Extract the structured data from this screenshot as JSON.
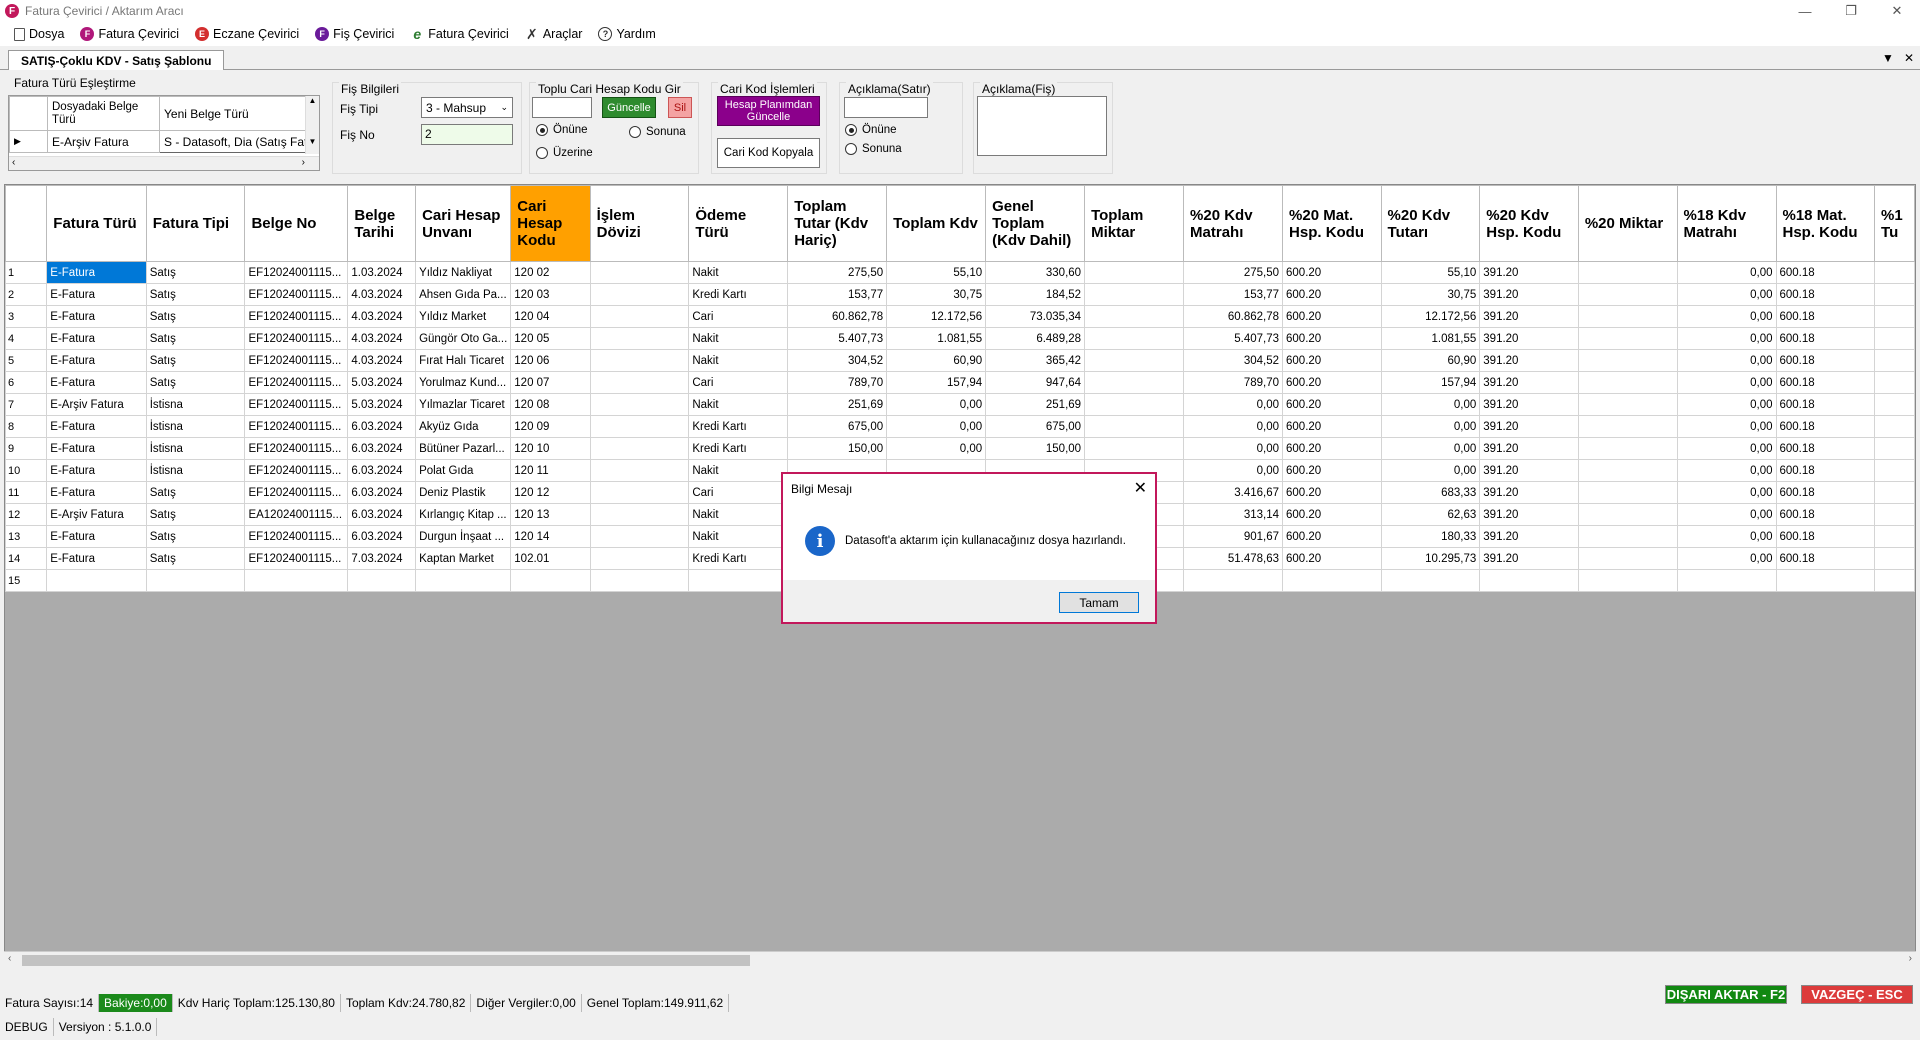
{
  "window": {
    "title": "Fatura Çevirici / Aktarım Aracı",
    "logo_letter": "F"
  },
  "menu": [
    {
      "label": "Dosya",
      "icon": "document-icon"
    },
    {
      "label": "Fatura Çevirici",
      "icon": "f-logo-icon"
    },
    {
      "label": "Eczane Çevirici",
      "icon": "e-logo-icon"
    },
    {
      "label": "Fiş Çevirici",
      "icon": "fis-logo-icon"
    },
    {
      "label": "Fatura Çevirici",
      "icon": "efatura-icon"
    },
    {
      "label": "Araçlar",
      "icon": "tools-icon"
    },
    {
      "label": "Yardım",
      "icon": "help-icon"
    }
  ],
  "tab": {
    "label": "SATIŞ-Çoklu KDV - Satış Şablonu"
  },
  "mapping": {
    "title": "Fatura Türü Eşleştirme",
    "col1": "Dosyadaki Belge Türü",
    "col2": "Yeni Belge Türü",
    "row_source": "E-Arşiv Fatura",
    "row_target": "S - Datasoft, Dia (Satış Fat"
  },
  "fis": {
    "title": "Fiş Bilgileri",
    "tipi_label": "Fiş Tipi",
    "tipi_value": "3 - Mahsup",
    "no_label": "Fiş No",
    "no_value": "2"
  },
  "toplu": {
    "title": "Toplu Cari Hesap Kodu Gir",
    "input_value": "",
    "update_btn": "Güncelle",
    "delete_btn": "Sil",
    "opt_onune": "Önüne",
    "opt_sonuna": "Sonuna",
    "opt_uzerine": "Üzerine"
  },
  "cari_islem": {
    "title": "Cari Kod İşlemleri",
    "btn_update": "Hesap Planımdan Güncelle",
    "btn_copy": "Cari Kod Kopyala"
  },
  "aciklama_satir": {
    "title": "Açıklama(Satır)",
    "value": "",
    "opt_onune": "Önüne",
    "opt_sonuna": "Sonuna"
  },
  "aciklama_fis": {
    "title": "Açıklama(Fiş)",
    "value": ""
  },
  "grid": {
    "headers": [
      "Fatura Türü",
      "Fatura Tipi",
      "Belge No",
      "Belge Tarihi",
      "Cari Hesap Unvanı",
      "Cari Hesap Kodu",
      "İşlem Dövizi",
      "Ödeme Türü",
      "Toplam Tutar (Kdv Hariç)",
      "Toplam Kdv",
      "Genel Toplam (Kdv Dahil)",
      "Toplam Miktar",
      "%20 Kdv Matrahı",
      "%20 Mat. Hsp. Kodu",
      "%20 Kdv Tutarı",
      "%20 Kdv Hsp. Kodu",
      "%20 Miktar",
      "%18 Kdv Matrahı",
      "%18 Mat. Hsp. Kodu",
      "%1 Tu"
    ],
    "rows": [
      [
        "1",
        "E-Fatura",
        "Satış",
        "EF12024001115...",
        "1.03.2024",
        "Yıldız Nakliyat",
        "120 02",
        "",
        "Nakit",
        "275,50",
        "55,10",
        "330,60",
        "",
        "275,50",
        "600.20",
        "55,10",
        "391.20",
        "",
        "0,00",
        "600.18",
        ""
      ],
      [
        "2",
        "E-Fatura",
        "Satış",
        "EF12024001115...",
        "4.03.2024",
        "Ahsen Gıda Pa...",
        "120 03",
        "",
        "Kredi Kartı",
        "153,77",
        "30,75",
        "184,52",
        "",
        "153,77",
        "600.20",
        "30,75",
        "391.20",
        "",
        "0,00",
        "600.18",
        ""
      ],
      [
        "3",
        "E-Fatura",
        "Satış",
        "EF12024001115...",
        "4.03.2024",
        "Yıldız Market",
        "120 04",
        "",
        "Cari",
        "60.862,78",
        "12.172,56",
        "73.035,34",
        "",
        "60.862,78",
        "600.20",
        "12.172,56",
        "391.20",
        "",
        "0,00",
        "600.18",
        ""
      ],
      [
        "4",
        "E-Fatura",
        "Satış",
        "EF12024001115...",
        "4.03.2024",
        "Güngör Oto Ga...",
        "120 05",
        "",
        "Nakit",
        "5.407,73",
        "1.081,55",
        "6.489,28",
        "",
        "5.407,73",
        "600.20",
        "1.081,55",
        "391.20",
        "",
        "0,00",
        "600.18",
        ""
      ],
      [
        "5",
        "E-Fatura",
        "Satış",
        "EF12024001115...",
        "4.03.2024",
        "Fırat Halı Ticaret",
        "120 06",
        "",
        "Nakit",
        "304,52",
        "60,90",
        "365,42",
        "",
        "304,52",
        "600.20",
        "60,90",
        "391.20",
        "",
        "0,00",
        "600.18",
        ""
      ],
      [
        "6",
        "E-Fatura",
        "Satış",
        "EF12024001115...",
        "5.03.2024",
        "Yorulmaz Kund...",
        "120 07",
        "",
        "Cari",
        "789,70",
        "157,94",
        "947,64",
        "",
        "789,70",
        "600.20",
        "157,94",
        "391.20",
        "",
        "0,00",
        "600.18",
        ""
      ],
      [
        "7",
        "E-Arşiv Fatura",
        "İstisna",
        "EF12024001115...",
        "5.03.2024",
        "Yılmazlar Ticaret",
        "120 08",
        "",
        "Nakit",
        "251,69",
        "0,00",
        "251,69",
        "",
        "0,00",
        "600.20",
        "0,00",
        "391.20",
        "",
        "0,00",
        "600.18",
        ""
      ],
      [
        "8",
        "E-Fatura",
        "İstisna",
        "EF12024001115...",
        "6.03.2024",
        "Akyüz Gıda",
        "120 09",
        "",
        "Kredi Kartı",
        "675,00",
        "0,00",
        "675,00",
        "",
        "0,00",
        "600.20",
        "0,00",
        "391.20",
        "",
        "0,00",
        "600.18",
        ""
      ],
      [
        "9",
        "E-Fatura",
        "İstisna",
        "EF12024001115...",
        "6.03.2024",
        "Bütüner Pazarl...",
        "120 10",
        "",
        "Kredi Kartı",
        "150,00",
        "0,00",
        "150,00",
        "",
        "0,00",
        "600.20",
        "0,00",
        "391.20",
        "",
        "0,00",
        "600.18",
        ""
      ],
      [
        "10",
        "E-Fatura",
        "İstisna",
        "EF12024001115...",
        "6.03.2024",
        "Polat Gıda",
        "120 11",
        "",
        "Nakit",
        "",
        "",
        "",
        "",
        "0,00",
        "600.20",
        "0,00",
        "391.20",
        "",
        "0,00",
        "600.18",
        ""
      ],
      [
        "11",
        "E-Fatura",
        "Satış",
        "EF12024001115...",
        "6.03.2024",
        "Deniz Plastik",
        "120 12",
        "",
        "Cari",
        "",
        "",
        "",
        "",
        "3.416,67",
        "600.20",
        "683,33",
        "391.20",
        "",
        "0,00",
        "600.18",
        ""
      ],
      [
        "12",
        "E-Arşiv Fatura",
        "Satış",
        "EA12024001115...",
        "6.03.2024",
        "Kırlangıç Kitap ...",
        "120 13",
        "",
        "Nakit",
        "",
        "",
        "",
        "",
        "313,14",
        "600.20",
        "62,63",
        "391.20",
        "",
        "0,00",
        "600.18",
        ""
      ],
      [
        "13",
        "E-Fatura",
        "Satış",
        "EF12024001115...",
        "6.03.2024",
        "Durgun İnşaat ...",
        "120 14",
        "",
        "Nakit",
        "",
        "",
        "",
        "",
        "901,67",
        "600.20",
        "180,33",
        "391.20",
        "",
        "0,00",
        "600.18",
        ""
      ],
      [
        "14",
        "E-Fatura",
        "Satış",
        "EF12024001115...",
        "7.03.2024",
        "Kaptan Market",
        "102.01",
        "",
        "Kredi Kartı",
        "",
        "",
        "",
        "",
        "51.478,63",
        "600.20",
        "10.295,73",
        "391.20",
        "",
        "0,00",
        "600.18",
        ""
      ]
    ],
    "new_row_label": "15"
  },
  "status": {
    "fatura_sayisi": "Fatura Sayısı:14",
    "bakiye": "Bakiye:0,00",
    "kdv_haric": "Kdv Hariç Toplam:125.130,80",
    "toplam_kdv": "Toplam Kdv:24.780,82",
    "diger": "Diğer Vergiler:0,00",
    "genel": "Genel Toplam:149.911,62",
    "export_btn": "DIŞARI AKTAR - F2",
    "cancel_btn": "VAZGEÇ - ESC",
    "debug": "DEBUG",
    "version": "Versiyon : 5.1.0.0"
  },
  "dialog": {
    "title": "Bilgi Mesajı",
    "message": "Datasoft'a aktarım için kullanacağınız dosya hazırlandı.",
    "ok": "Tamam"
  }
}
